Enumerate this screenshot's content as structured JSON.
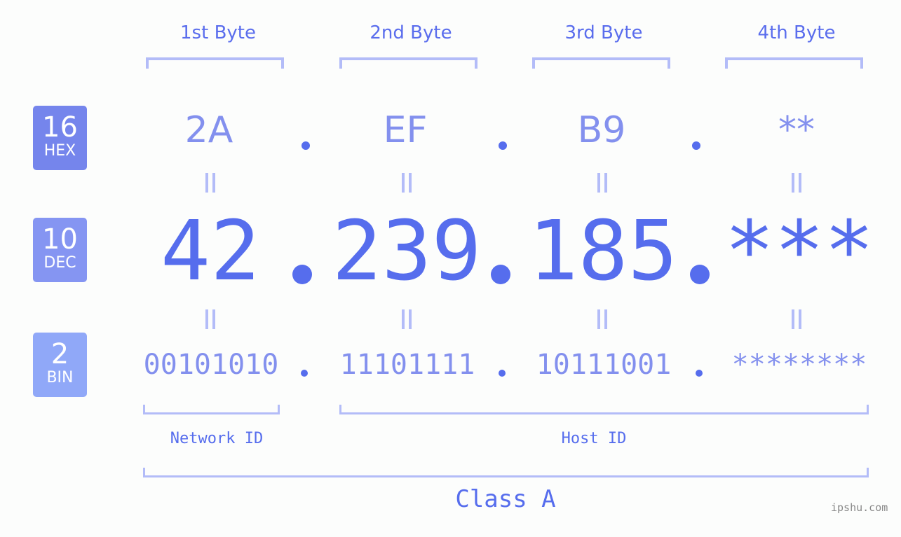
{
  "badges": [
    {
      "number": "16",
      "label": "HEX",
      "color": "#7585ec"
    },
    {
      "number": "10",
      "label": "DEC",
      "color": "#8595f2"
    },
    {
      "number": "2",
      "label": "BIN",
      "color": "#90a8f8"
    }
  ],
  "byte_headers": [
    "1st Byte",
    "2nd Byte",
    "3rd Byte",
    "4th Byte"
  ],
  "hex": [
    "2A",
    "EF",
    "B9",
    "**"
  ],
  "dec": [
    "42",
    "239",
    "185",
    "***"
  ],
  "bin": [
    "00101010",
    "11101111",
    "10111001",
    "********"
  ],
  "separator": ".",
  "network_id_label": "Network ID",
  "host_id_label": "Host ID",
  "class_label": "Class A",
  "watermark": "ipshu.com",
  "colors": {
    "accent": "#566ded",
    "light": "#8390ee",
    "bracket": "#b3bcf8"
  }
}
